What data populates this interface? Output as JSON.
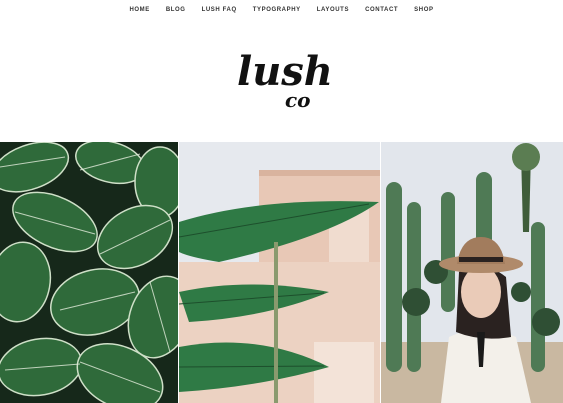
{
  "nav": {
    "items": [
      {
        "label": "HOME"
      },
      {
        "label": "BLOG"
      },
      {
        "label": "LUSH FAQ"
      },
      {
        "label": "TYPOGRAPHY"
      },
      {
        "label": "LAYOUTS"
      },
      {
        "label": "CONTACT"
      },
      {
        "label": "SHOP"
      }
    ]
  },
  "logo": {
    "text": "lush",
    "sub": "co"
  },
  "gallery": {
    "photos": [
      {
        "subject": "tropical leaves"
      },
      {
        "subject": "banana leaves and pink wall"
      },
      {
        "subject": "woman in hat among cacti"
      }
    ]
  },
  "colors": {
    "leaf_dark": "#1f3a24",
    "leaf_green": "#2e6b3a",
    "wall_pink": "#e9c9b8",
    "sky": "#e4e8ef",
    "hat": "#b08a6a"
  }
}
